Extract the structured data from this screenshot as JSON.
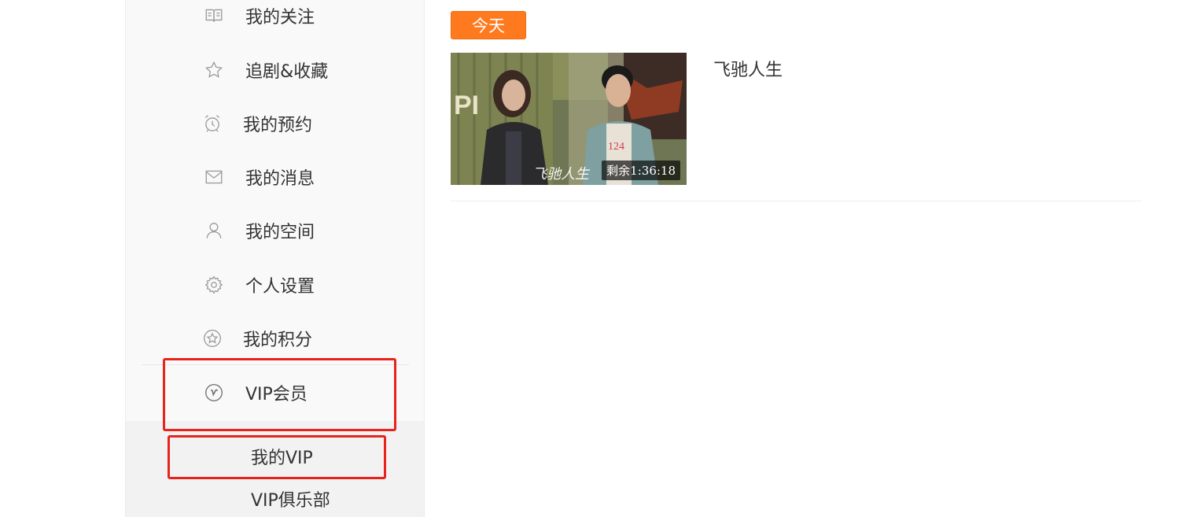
{
  "sidebar": {
    "items": [
      {
        "icon": "book-icon",
        "label": "我的关注"
      },
      {
        "icon": "star-icon",
        "label": "追剧&收藏"
      },
      {
        "icon": "alarm-clock-icon",
        "label": "我的预约"
      },
      {
        "icon": "mail-icon",
        "label": "我的消息"
      },
      {
        "icon": "user-icon",
        "label": "我的空间"
      },
      {
        "icon": "gear-icon",
        "label": "个人设置"
      },
      {
        "icon": "points-badge-icon",
        "label": "我的积分"
      },
      {
        "icon": "vip-icon",
        "label": "VIP会员"
      }
    ],
    "submenu": [
      {
        "label": "我的VIP"
      },
      {
        "label": "VIP俱乐部"
      }
    ]
  },
  "main": {
    "date_tag": "今天",
    "history": [
      {
        "title": "飞驰人生",
        "remaining": "剩余1:36:18",
        "thumbnail_caption": "飞驰人生"
      }
    ]
  },
  "colors": {
    "accent_orange": "#ff7a1f",
    "highlight_red": "#e8231c"
  }
}
